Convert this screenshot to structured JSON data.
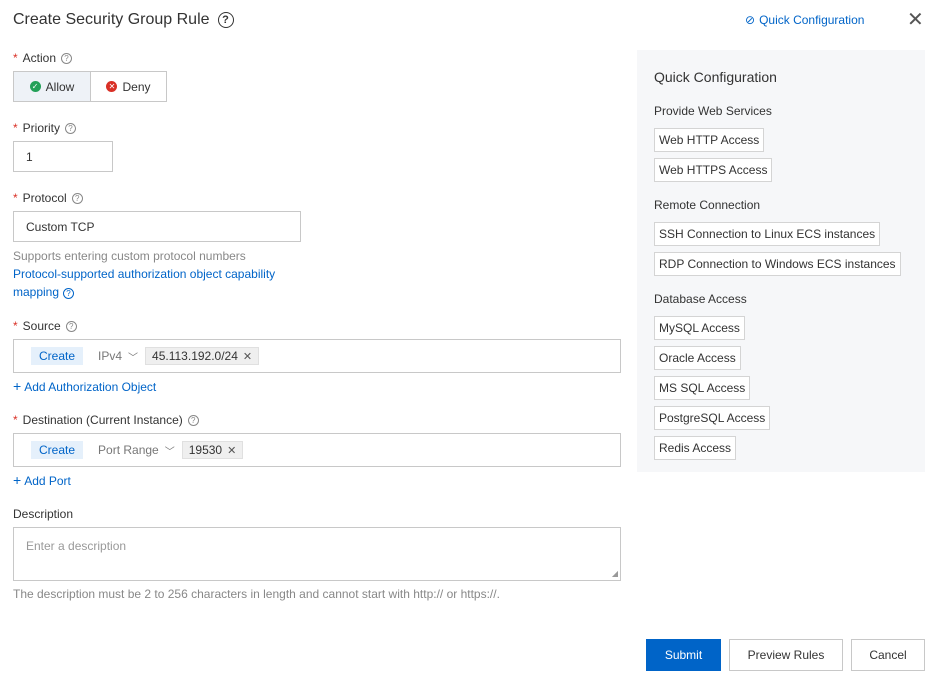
{
  "dialog": {
    "title": "Create Security Group Rule",
    "quick_config_link": "Quick Configuration"
  },
  "form": {
    "action": {
      "label": "Action",
      "options": [
        "Allow",
        "Deny"
      ],
      "selected": "Allow"
    },
    "priority": {
      "label": "Priority",
      "value": "1"
    },
    "protocol": {
      "label": "Protocol",
      "value": "Custom TCP",
      "hint": "Supports entering custom protocol numbers",
      "link_line1": "Protocol-supported authorization object capability",
      "link_line2": "mapping"
    },
    "source": {
      "label": "Source",
      "create": "Create",
      "ip_type": "IPv4",
      "chip": "45.113.192.0/24",
      "add_label": "Add Authorization Object"
    },
    "destination": {
      "label": "Destination (Current Instance)",
      "create": "Create",
      "port_type": "Port Range",
      "chip": "19530",
      "add_label": "Add Port"
    },
    "description": {
      "label": "Description",
      "placeholder": "Enter a description",
      "hint": "The description must be 2 to 256 characters in length and cannot start with http:// or https://."
    }
  },
  "quick_panel": {
    "title": "Quick Configuration",
    "groups": [
      {
        "title": "Provide Web Services",
        "items": [
          "Web HTTP Access",
          "Web HTTPS Access"
        ]
      },
      {
        "title": "Remote Connection",
        "items": [
          "SSH Connection to Linux ECS instances",
          "RDP Connection to Windows ECS instances"
        ]
      },
      {
        "title": "Database Access",
        "items": [
          "MySQL Access",
          "Oracle Access",
          "MS SQL Access",
          "PostgreSQL Access",
          "Redis Access"
        ]
      }
    ]
  },
  "footer": {
    "submit": "Submit",
    "preview": "Preview Rules",
    "cancel": "Cancel"
  },
  "colors": {
    "primary": "#0064c8",
    "required": "#d93026",
    "allow": "#23a058",
    "deny": "#d93026"
  }
}
